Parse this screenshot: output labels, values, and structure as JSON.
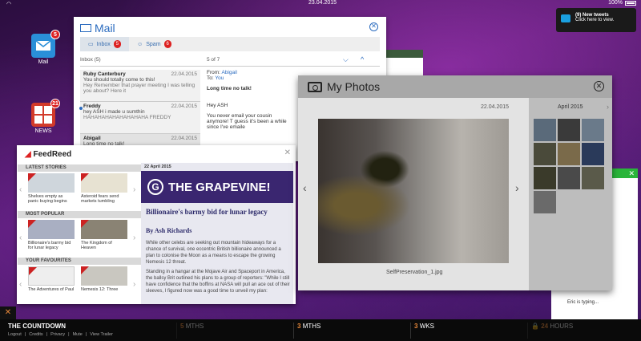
{
  "status_bar": {
    "time": "23.04.2015",
    "battery": "100%"
  },
  "desktop": {
    "mail_icon": {
      "label": "Mail",
      "badge": "5"
    },
    "news_icon": {
      "label": "NEWS",
      "badge": "21"
    }
  },
  "notification": {
    "title": "(9) New tweets",
    "subtitle": "Click here to view."
  },
  "mail": {
    "title": "Mail",
    "tabs": [
      {
        "label": "Inbox",
        "count": "5"
      },
      {
        "label": "Spam",
        "count": "6"
      }
    ],
    "list_header": "Inbox (5)",
    "pager": "5 of 7",
    "messages": [
      {
        "from": "Ruby Canterbury",
        "date": "22.04.2015",
        "subject": "You should totally come to this!",
        "preview": "Hey Remember that prayer meeting I was telling you about? Here it"
      },
      {
        "from": "Freddy",
        "date": "22.04.2015",
        "subject": "hey ASH i made u sumthin",
        "preview": "HAHAHAHAHAHAHAHAHA FREDDY"
      },
      {
        "from": "Abigail",
        "date": "22.04.2015",
        "subject": "Long time no talk!",
        "preview": ""
      }
    ],
    "reader": {
      "from_label": "From:",
      "from": "Abigail",
      "to_label": "To:",
      "to": "You",
      "date": "22.04.2015",
      "subject": "Long time no talk!",
      "greeting": "Hey ASH",
      "body": "You never email your cousin anymore! T guess it's been a while since I've emaile"
    }
  },
  "feed": {
    "logo": "FeedReed",
    "sections": [
      {
        "title": "LATEST STORIES",
        "items": [
          "Shelves empty as panic buying begins",
          "Asteroid fears send markets tumbling"
        ]
      },
      {
        "title": "MOST POPULAR",
        "items": [
          "Billionaire's barmy bid for lunar legacy",
          "The Kingdom of Heaven"
        ]
      },
      {
        "title": "YOUR FAVOURITES",
        "items": [
          "The Adventures of Paul",
          "Nemesis 12: Three"
        ]
      }
    ],
    "article": {
      "date": "22 April 2015",
      "masthead": "THE GRAPEVINE!",
      "masthead_icon": "G",
      "headline": "Billionaire's barmy bid for lunar legacy",
      "byline": "By Ash Richards",
      "para1": "While other celebs are seeking out mountain hideaways for a chance of survival, one eccentric British billionaire announced a plan to colonise the Moon as a means to escape the growing Nemesis 12 threat.",
      "para2": "Standing in a hangar at the Mojave Air and Spaceport in America, the ballsy Brit outlined his plans to a group of reporters: \"While I still have confidence that the boffins at NASA will pull an ace out of their sleeves, I figured now was a good time to unveil my plan:"
    }
  },
  "photos": {
    "title": "My Photos",
    "date": "22.04.2015",
    "caption": "SelfPreservation_1.jpg",
    "month": "April 2015",
    "thumb_colors": [
      "#5a6a7a",
      "#3a3a3a",
      "#6a7a8a",
      "#4a4a3a",
      "#7a6a4a",
      "#2a3a5a",
      "#3a3a2a",
      "#4a4a4a",
      "#5a5a4a",
      "#6a6a6a"
    ]
  },
  "chat": {
    "typing": "Eric is typing..."
  },
  "bottom_bar": {
    "title": "THE COUNTDOWN",
    "links": [
      "Logout",
      "Credits",
      "Privacy",
      "Mute",
      "View Trailer"
    ],
    "countdown": [
      {
        "num": "5",
        "unit": "MTHS"
      },
      {
        "num": "3",
        "unit": "MTHS"
      },
      {
        "num": "3",
        "unit": "WKS"
      },
      {
        "num": "24",
        "unit": "HOURS"
      }
    ],
    "close_icon": "✕"
  }
}
